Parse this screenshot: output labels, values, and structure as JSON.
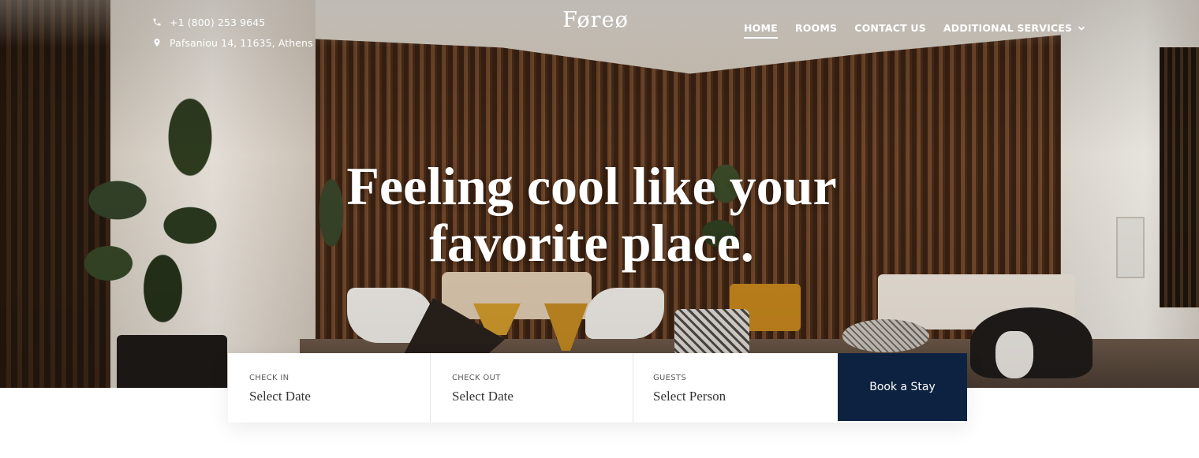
{
  "header": {
    "phone": "+1 (800) 253 9645",
    "address": "Pafsaniou 14, 11635, Athens",
    "logo": "Føreø",
    "nav": [
      {
        "label": "HOME",
        "active": true
      },
      {
        "label": "ROOMS",
        "active": false
      },
      {
        "label": "CONTACT US",
        "active": false
      },
      {
        "label": "ADDITIONAL SERVICES",
        "active": false,
        "dropdown": true
      }
    ]
  },
  "hero": {
    "headline_line1": "Feeling cool like your",
    "headline_line2": "favorite place."
  },
  "booking": {
    "check_in": {
      "label": "CHECK IN",
      "value": "Select Date"
    },
    "check_out": {
      "label": "CHECK OUT",
      "value": "Select Date"
    },
    "guests": {
      "label": "GUESTS",
      "value": "Select Person"
    },
    "button_label": "Book a Stay"
  },
  "icons": {
    "phone": "phone-icon",
    "location": "map-pin-icon",
    "dropdown": "chevron-down-icon"
  },
  "colors": {
    "primary_button": "#0d2240",
    "text_on_hero": "#ffffff"
  }
}
